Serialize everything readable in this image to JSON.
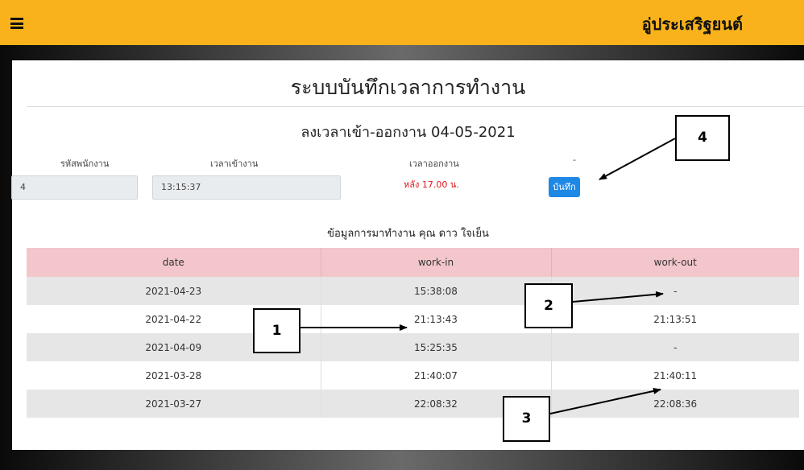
{
  "header": {
    "brand": "อู่ประเสริฐยนต์",
    "menu_icon": "hamburger-menu-icon"
  },
  "page": {
    "title": "ระบบบันทึกเวลาการทำงาน",
    "subtitle": "ลงเวลาเข้า-ออกงาน 04-05-2021"
  },
  "form": {
    "employee_id_label": "รหัสพนักงาน",
    "employee_id_value": "4",
    "checkin_label": "เวลาเข้างาน",
    "checkin_value": "13:15:37",
    "checkout_label": "เวลาออกงาน",
    "checkout_note": "หลัง 17.00 น.",
    "dash": "-",
    "save_label": "บันทึก"
  },
  "table": {
    "caption": "ข้อมูลการมาทำงาน คุณ ดาว ใจเย็น",
    "headers": [
      "date",
      "work-in",
      "work-out"
    ],
    "rows": [
      [
        "2021-04-23",
        "15:38:08",
        "-"
      ],
      [
        "2021-04-22",
        "21:13:43",
        "21:13:51"
      ],
      [
        "2021-04-09",
        "15:25:35",
        "-"
      ],
      [
        "2021-03-28",
        "21:40:07",
        "21:40:11"
      ],
      [
        "2021-03-27",
        "22:08:32",
        "22:08:36"
      ]
    ]
  },
  "annotations": [
    "1",
    "2",
    "3",
    "4"
  ],
  "colors": {
    "topbar": "#f9b21b",
    "table_header": "#f2c6cb",
    "save_button": "#1e88e5",
    "warning_text": "#e1161b"
  }
}
